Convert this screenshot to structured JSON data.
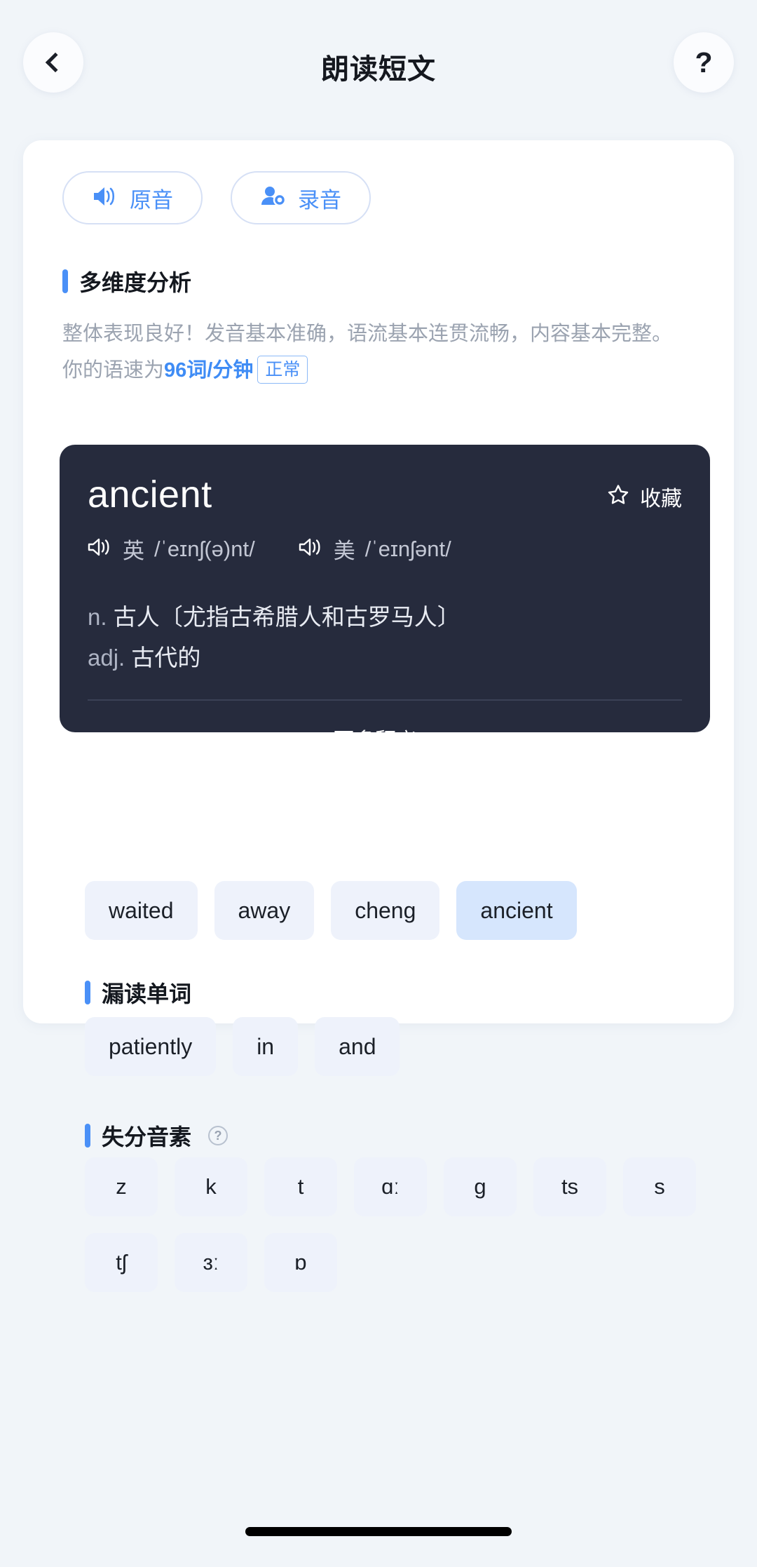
{
  "header": {
    "title": "朗读短文",
    "back_icon": "chevron-left-icon",
    "help_label": "?"
  },
  "audio_buttons": [
    {
      "label": "原音",
      "icon": "speaker-icon"
    },
    {
      "label": "录音",
      "icon": "person-record-icon"
    }
  ],
  "analysis": {
    "section_title": "多维度分析",
    "text_part1": "整体表现良好！发音基本准确，语流基本连贯流畅，内容基本完整。 你的语速为",
    "speed": "96词/分钟",
    "badge": "正常"
  },
  "word_card": {
    "word": "ancient",
    "favorite_label": "收藏",
    "favorite_icon": "star-outline-icon",
    "phonetics": [
      {
        "region": "英",
        "ipa": "/ˈeɪnʃ(ə)nt/",
        "icon": "speaker-icon"
      },
      {
        "region": "美",
        "ipa": "/ˈeɪnʃənt/",
        "icon": "speaker-icon"
      }
    ],
    "definitions": [
      {
        "pos": "n.",
        "meaning": "古人〔尤指古希腊人和古罗马人〕"
      },
      {
        "pos": "adj.",
        "meaning": "古代的"
      }
    ],
    "more_label": "更多释义",
    "more_icon": "chevron-right-icon"
  },
  "word_chips": [
    {
      "label": "waited",
      "selected": false
    },
    {
      "label": "away",
      "selected": false
    },
    {
      "label": "cheng",
      "selected": false
    },
    {
      "label": "ancient",
      "selected": true
    }
  ],
  "missed_words": {
    "section_title": "漏读单词",
    "items": [
      "patiently",
      "in",
      "and"
    ]
  },
  "phonemes": {
    "section_title": "失分音素",
    "help_label": "?",
    "items": [
      "z",
      "k",
      "t",
      "ɑː",
      "g",
      "ts",
      "s",
      "tʃ",
      "ɜː",
      "ɒ"
    ]
  },
  "colors": {
    "accent": "#4a90f7",
    "card_dark": "#262b3d",
    "page_bg": "#f1f5f9",
    "chip_bg": "#eef2fb",
    "chip_selected_bg": "#d6e6fd"
  }
}
